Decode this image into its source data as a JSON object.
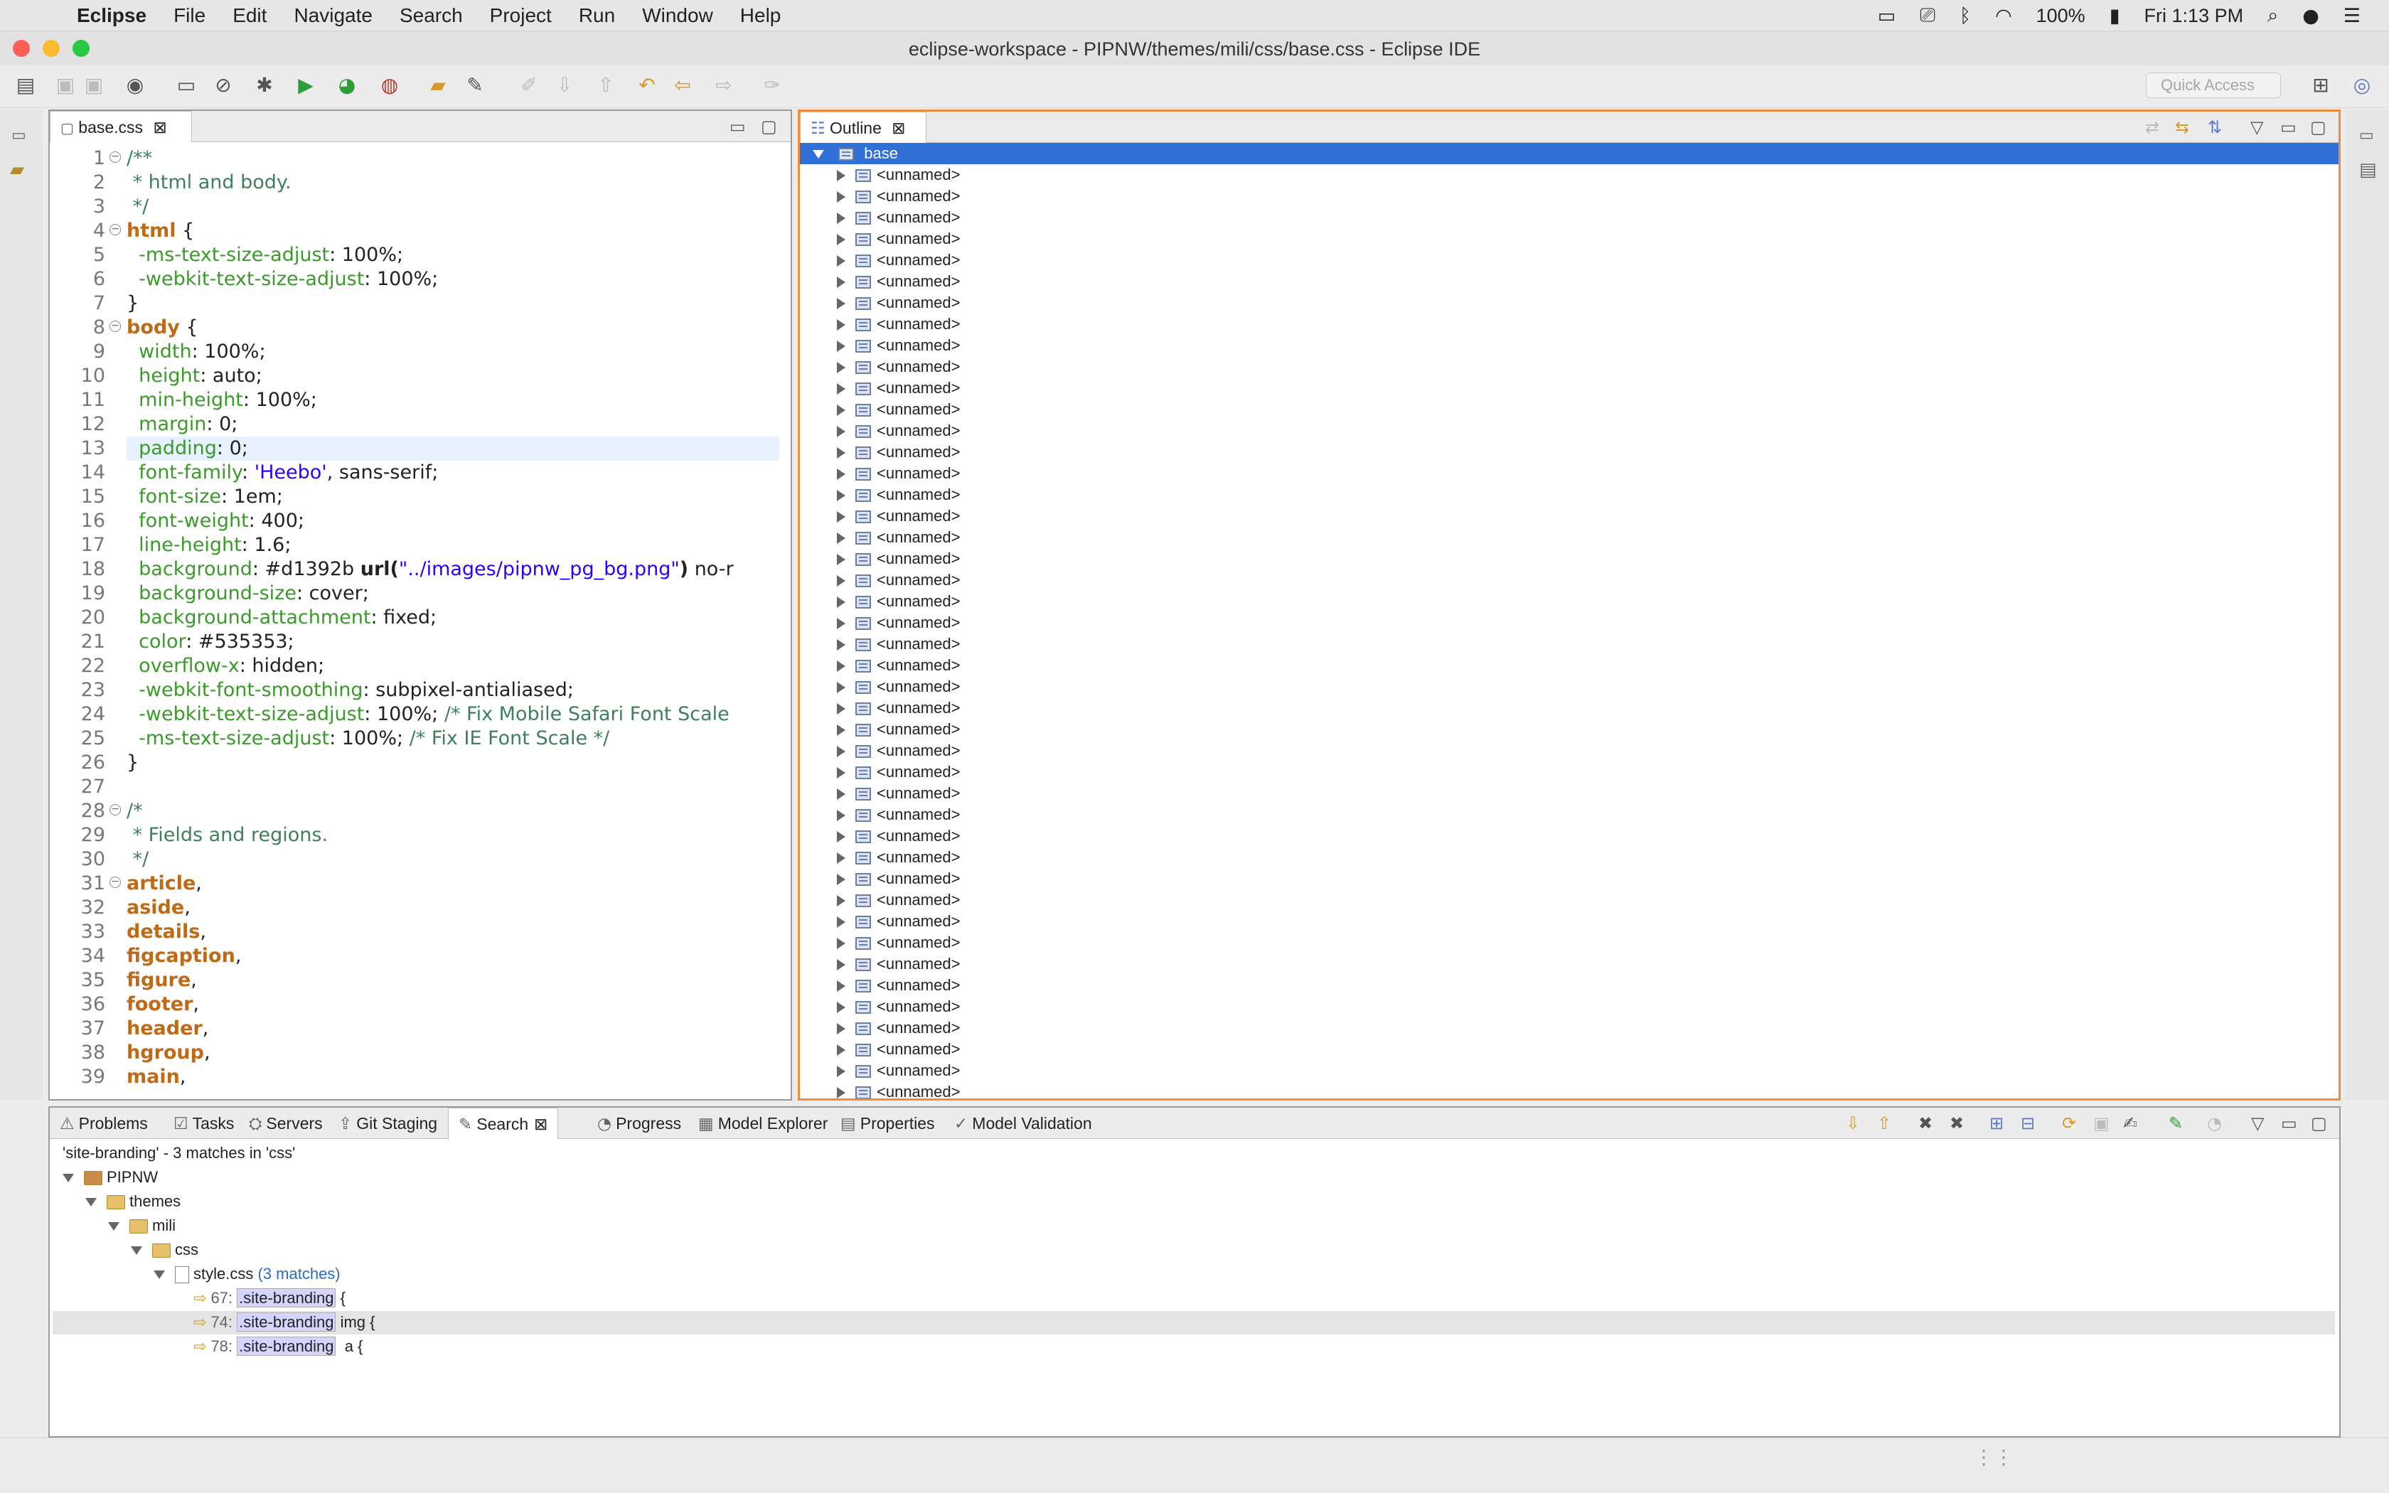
{
  "menubar": {
    "app": "Eclipse",
    "items": [
      "File",
      "Edit",
      "Navigate",
      "Search",
      "Project",
      "Run",
      "Window",
      "Help"
    ],
    "battery": "100%",
    "clock": "Fri 1:13 PM"
  },
  "window": {
    "title": "eclipse-workspace - PIPNW/themes/mili/css/base.css - Eclipse IDE"
  },
  "toolbar": {
    "quick_access_placeholder": "Quick Access"
  },
  "editor": {
    "tab_label": "base.css",
    "lines": [
      {
        "n": "1",
        "t": "/**"
      },
      {
        "n": "2",
        "t": " * html and body."
      },
      {
        "n": "3",
        "t": " */"
      },
      {
        "n": "4",
        "t": "html {"
      },
      {
        "n": "5",
        "t": "  -ms-text-size-adjust: 100%;"
      },
      {
        "n": "6",
        "t": "  -webkit-text-size-adjust: 100%;"
      },
      {
        "n": "7",
        "t": "}"
      },
      {
        "n": "8",
        "t": "body {"
      },
      {
        "n": "9",
        "t": "  width: 100%;"
      },
      {
        "n": "10",
        "t": "  height: auto;"
      },
      {
        "n": "11",
        "t": "  min-height: 100%;"
      },
      {
        "n": "12",
        "t": "  margin: 0;"
      },
      {
        "n": "13",
        "t": "  padding: 0;"
      },
      {
        "n": "14",
        "t": "  font-family: 'Heebo', sans-serif;"
      },
      {
        "n": "15",
        "t": "  font-size: 1em;"
      },
      {
        "n": "16",
        "t": "  font-weight: 400;"
      },
      {
        "n": "17",
        "t": "  line-height: 1.6;"
      },
      {
        "n": "18",
        "t": "  background: #d1392b url(\"../images/pipnw_pg_bg.png\") no-r"
      },
      {
        "n": "19",
        "t": "  background-size: cover;"
      },
      {
        "n": "20",
        "t": "  background-attachment: fixed;"
      },
      {
        "n": "21",
        "t": "  color: #535353;"
      },
      {
        "n": "22",
        "t": "  overflow-x: hidden;"
      },
      {
        "n": "23",
        "t": "  -webkit-font-smoothing: subpixel-antialiased;"
      },
      {
        "n": "24",
        "t": "  -webkit-text-size-adjust: 100%; /* Fix Mobile Safari Font Scale"
      },
      {
        "n": "25",
        "t": "  -ms-text-size-adjust: 100%; /* Fix IE Font Scale */"
      },
      {
        "n": "26",
        "t": "}"
      },
      {
        "n": "27",
        "t": ""
      },
      {
        "n": "28",
        "t": "/*"
      },
      {
        "n": "29",
        "t": " * Fields and regions."
      },
      {
        "n": "30",
        "t": " */"
      },
      {
        "n": "31",
        "t": "article,"
      },
      {
        "n": "32",
        "t": "aside,"
      },
      {
        "n": "33",
        "t": "details,"
      },
      {
        "n": "34",
        "t": "figcaption,"
      },
      {
        "n": "35",
        "t": "figure,"
      },
      {
        "n": "36",
        "t": "footer,"
      },
      {
        "n": "37",
        "t": "header,"
      },
      {
        "n": "38",
        "t": "hgroup,"
      },
      {
        "n": "39",
        "t": "main,"
      }
    ]
  },
  "outline": {
    "tab_label": "Outline",
    "root": "base",
    "child_label": "<unnamed>"
  },
  "bottom_tabs": [
    "Problems",
    "Tasks",
    "Servers",
    "Git Staging",
    "Search",
    "Progress",
    "Model Explorer",
    "Properties",
    "Model Validation"
  ],
  "search": {
    "summary": "'site-branding' - 3 matches in 'css'",
    "tree": {
      "project": "PIPNW",
      "folder1": "themes",
      "folder2": "mili",
      "folder3": "css",
      "file": "style.css",
      "file_matches": "(3 matches)",
      "matches": [
        {
          "line": "67:",
          "match": ".site-branding",
          "rest": " {"
        },
        {
          "line": "74:",
          "match": ".site-branding",
          "rest": " img {"
        },
        {
          "line": "78:",
          "match": ".site-branding",
          "rest": "  a {"
        }
      ]
    }
  },
  "colors": {
    "selection": "#2f6fd6",
    "active_border": "#f08c3a",
    "comment": "#3f7f5f",
    "selector": "#bf6a16",
    "property": "#3a9a2a",
    "string": "#2a00ff"
  }
}
